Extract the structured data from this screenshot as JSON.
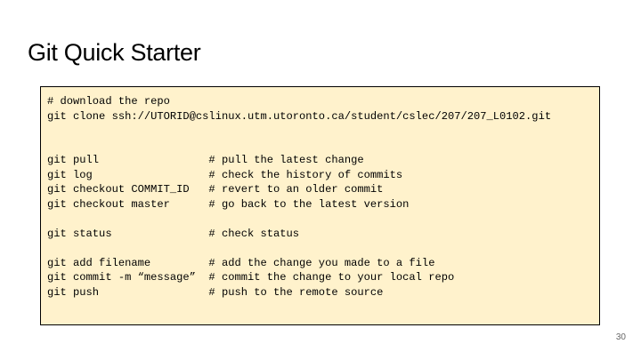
{
  "slide": {
    "title": "Git Quick Starter",
    "page_number": "30"
  },
  "code": {
    "lines": [
      "# download the repo",
      "git clone ssh://UTORID@cslinux.utm.utoronto.ca/student/cslec/207/207_L0102.git",
      "",
      "",
      "git pull                 # pull the latest change",
      "git log                  # check the history of commits",
      "git checkout COMMIT_ID   # revert to an older commit",
      "git checkout master      # go back to the latest version",
      "",
      "git status               # check status",
      "",
      "git add filename         # add the change you made to a file",
      "git commit -m “message”  # commit the change to your local repo",
      "git push                 # push to the remote source"
    ]
  }
}
